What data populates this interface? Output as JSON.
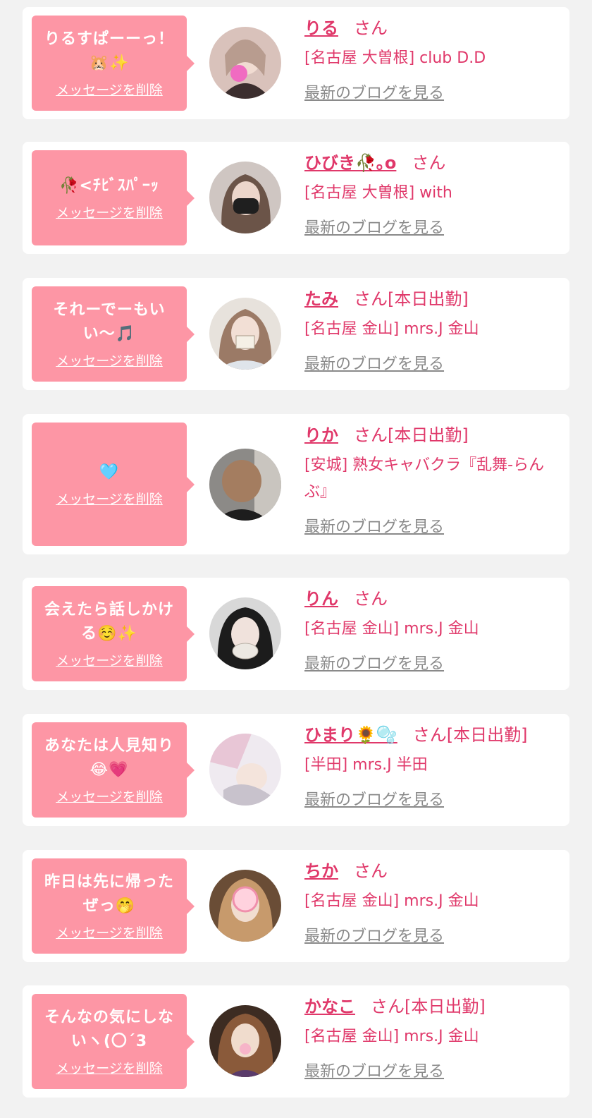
{
  "delete_label": "メッセージを削除",
  "blog_label": "最新のブログを見る",
  "san_label": "さん",
  "colors": {
    "accent": "#e0386a",
    "bubble": "#fd96a5",
    "muted": "#8a8a8a",
    "background": "#f2f2f2"
  },
  "cards": [
    {
      "message": "りるすぱーーっ！🐹✨",
      "name": "りる",
      "status": "",
      "shop": "[名古屋 大曽根] club D.D",
      "avatar_icon": "profile-photo"
    },
    {
      "message": "🥀<ﾁﾋﾞｽﾊﾟｰｯ",
      "name": "ひびき🥀｡o",
      "status": "",
      "shop": "[名古屋 大曽根] with",
      "avatar_icon": "profile-photo"
    },
    {
      "message": "それーでーもいい〜🎵",
      "name": "たみ",
      "status": "[本日出勤]",
      "shop": "[名古屋 金山] mrs.J 金山",
      "avatar_icon": "profile-photo"
    },
    {
      "message": "🩵",
      "name": "りか",
      "status": "[本日出勤]",
      "shop": "[安城] 熟女キャバクラ『乱舞-らんぶ』",
      "avatar_icon": "profile-photo"
    },
    {
      "message": "会えたら話しかける☺️✨",
      "name": "りん",
      "status": "",
      "shop": "[名古屋 金山] mrs.J 金山",
      "avatar_icon": "profile-photo"
    },
    {
      "message": "あなたは人見知り😂💗",
      "name": "ひまり🌻🫧",
      "status": "[本日出勤]",
      "shop": "[半田] mrs.J 半田",
      "avatar_icon": "profile-photo"
    },
    {
      "message": "昨日は先に帰ったぜっ🤭",
      "name": "ちか",
      "status": "",
      "shop": "[名古屋 金山] mrs.J 金山",
      "avatar_icon": "profile-photo"
    },
    {
      "message": "そんなの気にしないヽ(〇´3",
      "name": "かなこ",
      "status": "[本日出勤]",
      "shop": "[名古屋 金山] mrs.J 金山",
      "avatar_icon": "profile-photo"
    }
  ]
}
